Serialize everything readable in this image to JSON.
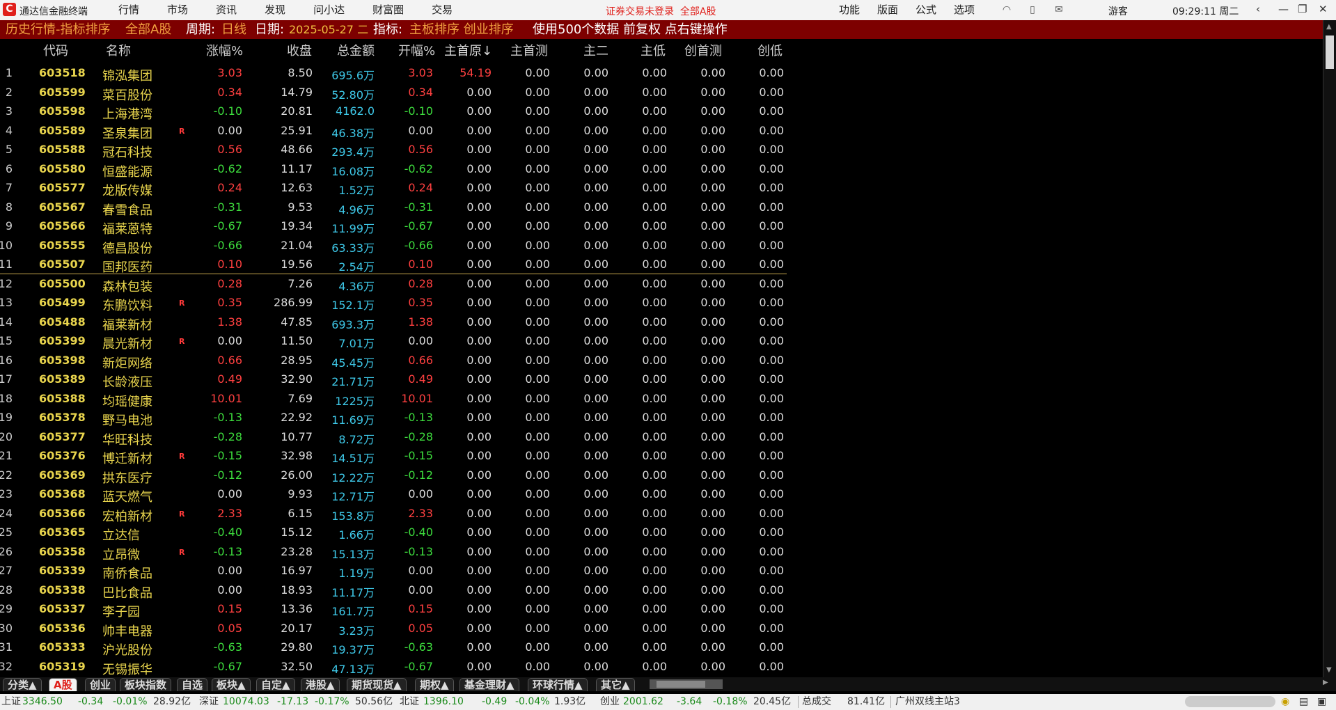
{
  "window": {
    "title": "通达信金融终端",
    "menu": [
      "行情",
      "市场",
      "资讯",
      "发现",
      "问小达",
      "财富圈",
      "交易"
    ],
    "trade_warning": "证券交易未登录",
    "trade_scope": "全部A股",
    "right_menu": [
      "功能",
      "版面",
      "公式",
      "选项"
    ],
    "user": "游客",
    "clock": "09:29:11 周二"
  },
  "strip": {
    "title": "历史行情-指标排序",
    "market": "全部A股",
    "period_label": "周期:",
    "period_value": "日线",
    "date_label": "日期:",
    "date_value": "2025-05-27 二",
    "indicator_label": "指标:",
    "indicator_value": "主板排序 创业排序",
    "use_text": "使用500个数据 前复权 点右键操作"
  },
  "columns": {
    "code": "代码",
    "name": "名称",
    "change": "涨幅%",
    "close": "收盘",
    "amount": "总金额",
    "open_change": "开幅%",
    "main_first_orig": "主首原↓",
    "main_first_test": "主首测",
    "main_two": "主二",
    "main_low": "主低",
    "chuang_first_test": "创首测",
    "chuang_low": "创低"
  },
  "rows": [
    {
      "no": "1",
      "code": "603518",
      "name": "锦泓集团",
      "r": "",
      "change": "3.03",
      "close": "8.50",
      "amount": "695.6万",
      "open": "3.03",
      "m1": "54.19",
      "m2": "0.00",
      "m3": "0.00",
      "m4": "0.00",
      "c1": "0.00",
      "c2": "0.00",
      "dir": "up"
    },
    {
      "no": "2",
      "code": "605599",
      "name": "菜百股份",
      "r": "",
      "change": "0.34",
      "close": "14.79",
      "amount": "52.80万",
      "open": "0.34",
      "m1": "0.00",
      "m2": "0.00",
      "m3": "0.00",
      "m4": "0.00",
      "c1": "0.00",
      "c2": "0.00",
      "dir": "up"
    },
    {
      "no": "3",
      "code": "605598",
      "name": "上海港湾",
      "r": "",
      "change": "-0.10",
      "close": "20.81",
      "amount": "4162.0",
      "open": "-0.10",
      "m1": "0.00",
      "m2": "0.00",
      "m3": "0.00",
      "m4": "0.00",
      "c1": "0.00",
      "c2": "0.00",
      "dir": "dn"
    },
    {
      "no": "4",
      "code": "605589",
      "name": "圣泉集团",
      "r": "R",
      "change": "0.00",
      "close": "25.91",
      "amount": "46.38万",
      "open": "0.00",
      "m1": "0.00",
      "m2": "0.00",
      "m3": "0.00",
      "m4": "0.00",
      "c1": "0.00",
      "c2": "0.00",
      "dir": "fl"
    },
    {
      "no": "5",
      "code": "605588",
      "name": "冠石科技",
      "r": "",
      "change": "0.56",
      "close": "48.66",
      "amount": "293.4万",
      "open": "0.56",
      "m1": "0.00",
      "m2": "0.00",
      "m3": "0.00",
      "m4": "0.00",
      "c1": "0.00",
      "c2": "0.00",
      "dir": "up"
    },
    {
      "no": "6",
      "code": "605580",
      "name": "恒盛能源",
      "r": "",
      "change": "-0.62",
      "close": "11.17",
      "amount": "16.08万",
      "open": "-0.62",
      "m1": "0.00",
      "m2": "0.00",
      "m3": "0.00",
      "m4": "0.00",
      "c1": "0.00",
      "c2": "0.00",
      "dir": "dn"
    },
    {
      "no": "7",
      "code": "605577",
      "name": "龙版传媒",
      "r": "",
      "change": "0.24",
      "close": "12.63",
      "amount": "1.52万",
      "open": "0.24",
      "m1": "0.00",
      "m2": "0.00",
      "m3": "0.00",
      "m4": "0.00",
      "c1": "0.00",
      "c2": "0.00",
      "dir": "up"
    },
    {
      "no": "8",
      "code": "605567",
      "name": "春雪食品",
      "r": "",
      "change": "-0.31",
      "close": "9.53",
      "amount": "4.96万",
      "open": "-0.31",
      "m1": "0.00",
      "m2": "0.00",
      "m3": "0.00",
      "m4": "0.00",
      "c1": "0.00",
      "c2": "0.00",
      "dir": "dn"
    },
    {
      "no": "9",
      "code": "605566",
      "name": "福莱蒽特",
      "r": "",
      "change": "-0.67",
      "close": "19.34",
      "amount": "11.99万",
      "open": "-0.67",
      "m1": "0.00",
      "m2": "0.00",
      "m3": "0.00",
      "m4": "0.00",
      "c1": "0.00",
      "c2": "0.00",
      "dir": "dn"
    },
    {
      "no": "10",
      "code": "605555",
      "name": "德昌股份",
      "r": "",
      "change": "-0.66",
      "close": "21.04",
      "amount": "63.33万",
      "open": "-0.66",
      "m1": "0.00",
      "m2": "0.00",
      "m3": "0.00",
      "m4": "0.00",
      "c1": "0.00",
      "c2": "0.00",
      "dir": "dn"
    },
    {
      "no": "11",
      "code": "605507",
      "name": "国邦医药",
      "r": "",
      "change": "0.10",
      "close": "19.56",
      "amount": "2.54万",
      "open": "0.10",
      "m1": "0.00",
      "m2": "0.00",
      "m3": "0.00",
      "m4": "0.00",
      "c1": "0.00",
      "c2": "0.00",
      "dir": "up"
    },
    {
      "no": "12",
      "code": "605500",
      "name": "森林包装",
      "r": "",
      "change": "0.28",
      "close": "7.26",
      "amount": "4.36万",
      "open": "0.28",
      "m1": "0.00",
      "m2": "0.00",
      "m3": "0.00",
      "m4": "0.00",
      "c1": "0.00",
      "c2": "0.00",
      "dir": "up"
    },
    {
      "no": "13",
      "code": "605499",
      "name": "东鹏饮料",
      "r": "R",
      "change": "0.35",
      "close": "286.99",
      "amount": "152.1万",
      "open": "0.35",
      "m1": "0.00",
      "m2": "0.00",
      "m3": "0.00",
      "m4": "0.00",
      "c1": "0.00",
      "c2": "0.00",
      "dir": "up"
    },
    {
      "no": "14",
      "code": "605488",
      "name": "福莱新材",
      "r": "",
      "change": "1.38",
      "close": "47.85",
      "amount": "693.3万",
      "open": "1.38",
      "m1": "0.00",
      "m2": "0.00",
      "m3": "0.00",
      "m4": "0.00",
      "c1": "0.00",
      "c2": "0.00",
      "dir": "up"
    },
    {
      "no": "15",
      "code": "605399",
      "name": "晨光新材",
      "r": "R",
      "change": "0.00",
      "close": "11.50",
      "amount": "7.01万",
      "open": "0.00",
      "m1": "0.00",
      "m2": "0.00",
      "m3": "0.00",
      "m4": "0.00",
      "c1": "0.00",
      "c2": "0.00",
      "dir": "fl"
    },
    {
      "no": "16",
      "code": "605398",
      "name": "新炬网络",
      "r": "",
      "change": "0.66",
      "close": "28.95",
      "amount": "45.45万",
      "open": "0.66",
      "m1": "0.00",
      "m2": "0.00",
      "m3": "0.00",
      "m4": "0.00",
      "c1": "0.00",
      "c2": "0.00",
      "dir": "up"
    },
    {
      "no": "17",
      "code": "605389",
      "name": "长龄液压",
      "r": "",
      "change": "0.49",
      "close": "32.90",
      "amount": "21.71万",
      "open": "0.49",
      "m1": "0.00",
      "m2": "0.00",
      "m3": "0.00",
      "m4": "0.00",
      "c1": "0.00",
      "c2": "0.00",
      "dir": "up"
    },
    {
      "no": "18",
      "code": "605388",
      "name": "均瑶健康",
      "r": "",
      "change": "10.01",
      "close": "7.69",
      "amount": "1225万",
      "open": "10.01",
      "m1": "0.00",
      "m2": "0.00",
      "m3": "0.00",
      "m4": "0.00",
      "c1": "0.00",
      "c2": "0.00",
      "dir": "up"
    },
    {
      "no": "19",
      "code": "605378",
      "name": "野马电池",
      "r": "",
      "change": "-0.13",
      "close": "22.92",
      "amount": "11.69万",
      "open": "-0.13",
      "m1": "0.00",
      "m2": "0.00",
      "m3": "0.00",
      "m4": "0.00",
      "c1": "0.00",
      "c2": "0.00",
      "dir": "dn"
    },
    {
      "no": "20",
      "code": "605377",
      "name": "华旺科技",
      "r": "",
      "change": "-0.28",
      "close": "10.77",
      "amount": "8.72万",
      "open": "-0.28",
      "m1": "0.00",
      "m2": "0.00",
      "m3": "0.00",
      "m4": "0.00",
      "c1": "0.00",
      "c2": "0.00",
      "dir": "dn"
    },
    {
      "no": "21",
      "code": "605376",
      "name": "博迁新材",
      "r": "R",
      "change": "-0.15",
      "close": "32.98",
      "amount": "14.51万",
      "open": "-0.15",
      "m1": "0.00",
      "m2": "0.00",
      "m3": "0.00",
      "m4": "0.00",
      "c1": "0.00",
      "c2": "0.00",
      "dir": "dn"
    },
    {
      "no": "22",
      "code": "605369",
      "name": "拱东医疗",
      "r": "",
      "change": "-0.12",
      "close": "26.00",
      "amount": "12.22万",
      "open": "-0.12",
      "m1": "0.00",
      "m2": "0.00",
      "m3": "0.00",
      "m4": "0.00",
      "c1": "0.00",
      "c2": "0.00",
      "dir": "dn"
    },
    {
      "no": "23",
      "code": "605368",
      "name": "蓝天燃气",
      "r": "",
      "change": "0.00",
      "close": "9.93",
      "amount": "12.71万",
      "open": "0.00",
      "m1": "0.00",
      "m2": "0.00",
      "m3": "0.00",
      "m4": "0.00",
      "c1": "0.00",
      "c2": "0.00",
      "dir": "fl"
    },
    {
      "no": "24",
      "code": "605366",
      "name": "宏柏新材",
      "r": "R",
      "change": "2.33",
      "close": "6.15",
      "amount": "153.8万",
      "open": "2.33",
      "m1": "0.00",
      "m2": "0.00",
      "m3": "0.00",
      "m4": "0.00",
      "c1": "0.00",
      "c2": "0.00",
      "dir": "up"
    },
    {
      "no": "25",
      "code": "605365",
      "name": "立达信",
      "r": "",
      "change": "-0.40",
      "close": "15.12",
      "amount": "1.66万",
      "open": "-0.40",
      "m1": "0.00",
      "m2": "0.00",
      "m3": "0.00",
      "m4": "0.00",
      "c1": "0.00",
      "c2": "0.00",
      "dir": "dn"
    },
    {
      "no": "26",
      "code": "605358",
      "name": "立昂微",
      "r": "R",
      "change": "-0.13",
      "close": "23.28",
      "amount": "15.13万",
      "open": "-0.13",
      "m1": "0.00",
      "m2": "0.00",
      "m3": "0.00",
      "m4": "0.00",
      "c1": "0.00",
      "c2": "0.00",
      "dir": "dn"
    },
    {
      "no": "27",
      "code": "605339",
      "name": "南侨食品",
      "r": "",
      "change": "0.00",
      "close": "16.97",
      "amount": "1.19万",
      "open": "0.00",
      "m1": "0.00",
      "m2": "0.00",
      "m3": "0.00",
      "m4": "0.00",
      "c1": "0.00",
      "c2": "0.00",
      "dir": "fl"
    },
    {
      "no": "28",
      "code": "605338",
      "name": "巴比食品",
      "r": "",
      "change": "0.00",
      "close": "18.93",
      "amount": "11.17万",
      "open": "0.00",
      "m1": "0.00",
      "m2": "0.00",
      "m3": "0.00",
      "m4": "0.00",
      "c1": "0.00",
      "c2": "0.00",
      "dir": "fl"
    },
    {
      "no": "29",
      "code": "605337",
      "name": "李子园",
      "r": "",
      "change": "0.15",
      "close": "13.36",
      "amount": "161.7万",
      "open": "0.15",
      "m1": "0.00",
      "m2": "0.00",
      "m3": "0.00",
      "m4": "0.00",
      "c1": "0.00",
      "c2": "0.00",
      "dir": "up"
    },
    {
      "no": "30",
      "code": "605336",
      "name": "帅丰电器",
      "r": "",
      "change": "0.05",
      "close": "20.17",
      "amount": "3.23万",
      "open": "0.05",
      "m1": "0.00",
      "m2": "0.00",
      "m3": "0.00",
      "m4": "0.00",
      "c1": "0.00",
      "c2": "0.00",
      "dir": "up"
    },
    {
      "no": "31",
      "code": "605333",
      "name": "沪光股份",
      "r": "",
      "change": "-0.63",
      "close": "29.80",
      "amount": "19.37万",
      "open": "-0.63",
      "m1": "0.00",
      "m2": "0.00",
      "m3": "0.00",
      "m4": "0.00",
      "c1": "0.00",
      "c2": "0.00",
      "dir": "dn"
    },
    {
      "no": "32",
      "code": "605319",
      "name": "无锡振华",
      "r": "",
      "change": "-0.67",
      "close": "32.50",
      "amount": "47.13万",
      "open": "-0.67",
      "m1": "0.00",
      "m2": "0.00",
      "m3": "0.00",
      "m4": "0.00",
      "c1": "0.00",
      "c2": "0.00",
      "dir": "dn"
    }
  ],
  "tabs": [
    "分类▲",
    "A股",
    "创业",
    "板块指数",
    "自选",
    "板块▲",
    "自定▲",
    "港股▲",
    "期货现货▲",
    "期权▲",
    "基金理财▲",
    "环球行情▲",
    "其它▲"
  ],
  "active_tab": "A股",
  "status": {
    "sh_label": "上证",
    "sh_value": "3346.50",
    "sh_chg": "-0.34",
    "sh_pct": "-0.01%",
    "sh_amt": "28.92亿",
    "sz_label": "深证",
    "sz_value": "10074.03",
    "sz_chg": "-17.13",
    "sz_pct": "-0.17%",
    "sz_amt": "50.56亿",
    "bz_label": "北证",
    "bz_value": "1396.10",
    "bz_chg": "-0.49",
    "bz_pct": "-0.04%",
    "bz_amt": "1.93亿",
    "cy_label": "创业",
    "cy_value": "2001.62",
    "cy_chg": "-3.64",
    "cy_pct": "-0.18%",
    "cy_amt": "20.45亿",
    "total_label": "总成交",
    "total_value": "81.41亿",
    "server": "广州双线主站3"
  },
  "colors": {
    "up": "#ff4040",
    "down": "#3ddc3d",
    "flat": "#dddddd",
    "code": "#e8d44d",
    "amount": "#3ec8e8",
    "strip": "#7d0000"
  }
}
